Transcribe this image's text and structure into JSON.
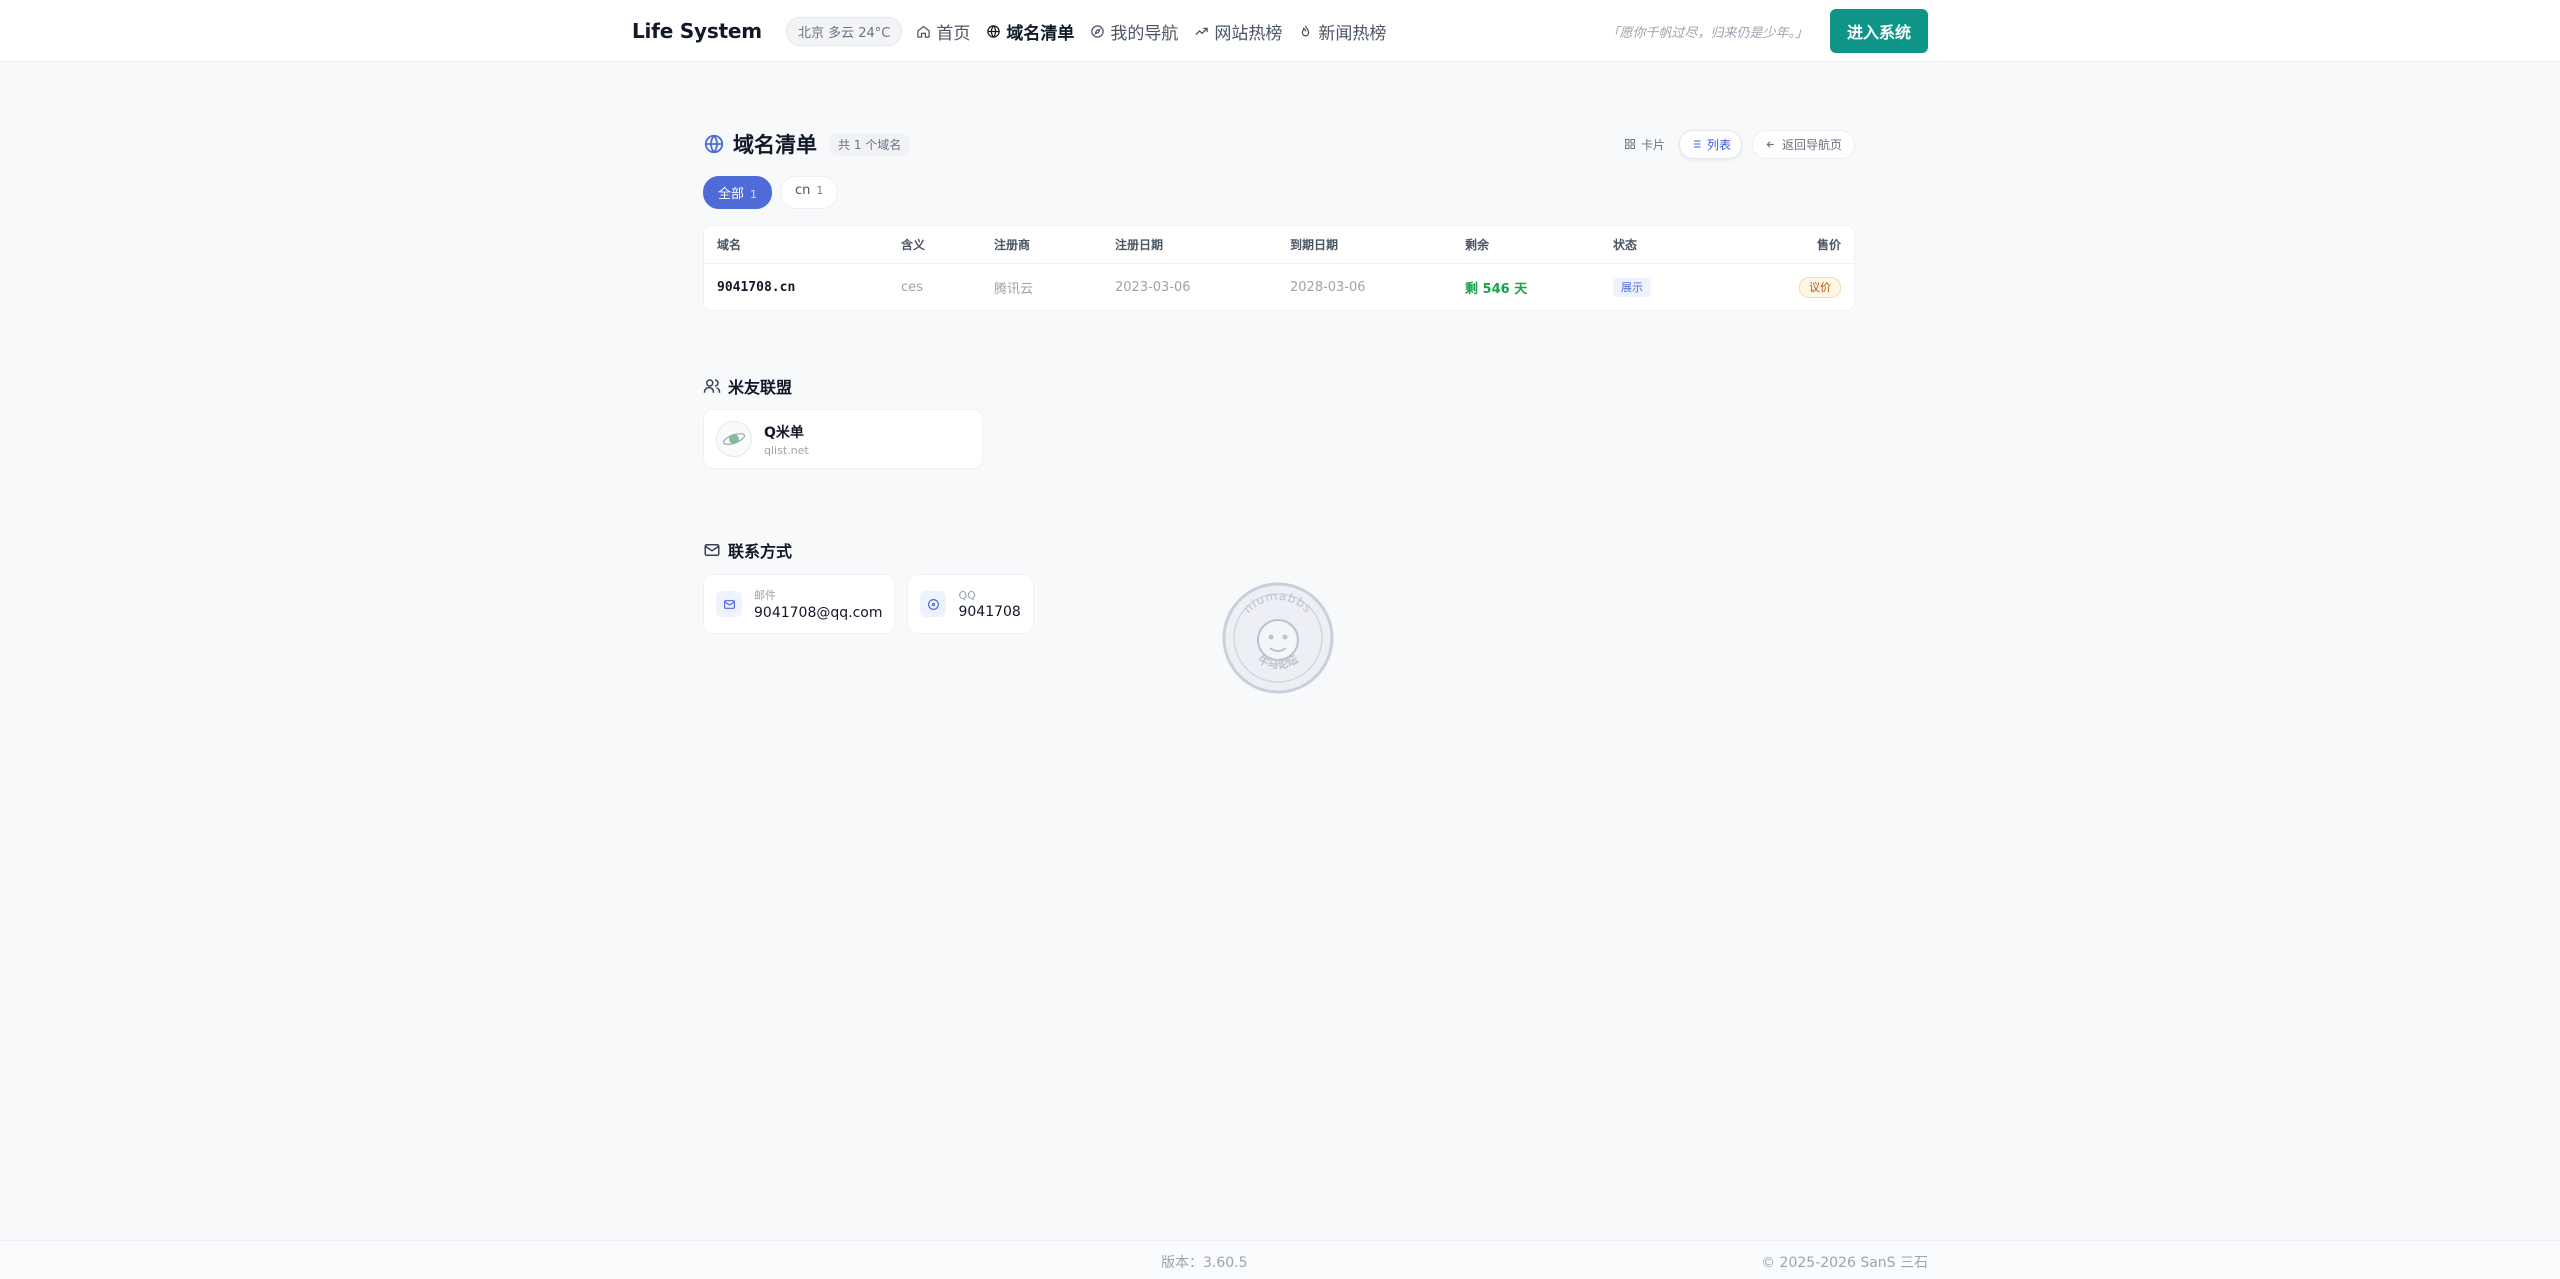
{
  "header": {
    "brand": "Life System",
    "weather": "北京 多云 24°C",
    "nav": [
      {
        "label": "首页",
        "icon": "home-icon",
        "active": false
      },
      {
        "label": "域名清单",
        "icon": "globe-icon",
        "active": true
      },
      {
        "label": "我的导航",
        "icon": "compass-icon",
        "active": false
      },
      {
        "label": "网站热榜",
        "icon": "trending-icon",
        "active": false
      },
      {
        "label": "新闻热榜",
        "icon": "flame-icon",
        "active": false
      }
    ],
    "slogan": "「愿你千帆过尽，归来仍是少年。」",
    "enter_button": "进入系统"
  },
  "domains": {
    "title": "域名清单",
    "count_badge": "共 1 个域名",
    "views": {
      "card": "卡片",
      "list": "列表",
      "active": "list"
    },
    "back": "返回导航页",
    "filters": [
      {
        "label": "全部",
        "count": "1",
        "active": true
      },
      {
        "label": "cn",
        "count": "1",
        "active": false
      }
    ],
    "columns": [
      "域名",
      "含义",
      "注册商",
      "注册日期",
      "到期日期",
      "剩余",
      "状态",
      "售价"
    ],
    "rows": [
      {
        "domain": "9041708.cn",
        "meaning": "ces",
        "registrar": "腾讯云",
        "registered": "2023-03-06",
        "expires": "2028-03-06",
        "remaining": "剩 546 天",
        "status": "展示",
        "price": "议价"
      }
    ]
  },
  "friends": {
    "title": "米友联盟",
    "items": [
      {
        "name": "Q米单",
        "url": "qlist.net"
      }
    ]
  },
  "contact": {
    "title": "联系方式",
    "items": [
      {
        "label": "邮件",
        "value": "9041708@qq.com",
        "icon": "mail-icon"
      },
      {
        "label": "QQ",
        "value": "9041708",
        "icon": "qq-icon"
      }
    ]
  },
  "watermark": {
    "top_text": "niumabbs",
    "bottom_text": "牛马论坛"
  },
  "footer": {
    "version": "版本：3.60.5",
    "copyright": "© 2025-2026 SanS 三石"
  },
  "colors": {
    "accent": "#4f6bd8",
    "enter_button": "#0f9488",
    "remaining": "#16a34a",
    "price": "#b45309"
  }
}
